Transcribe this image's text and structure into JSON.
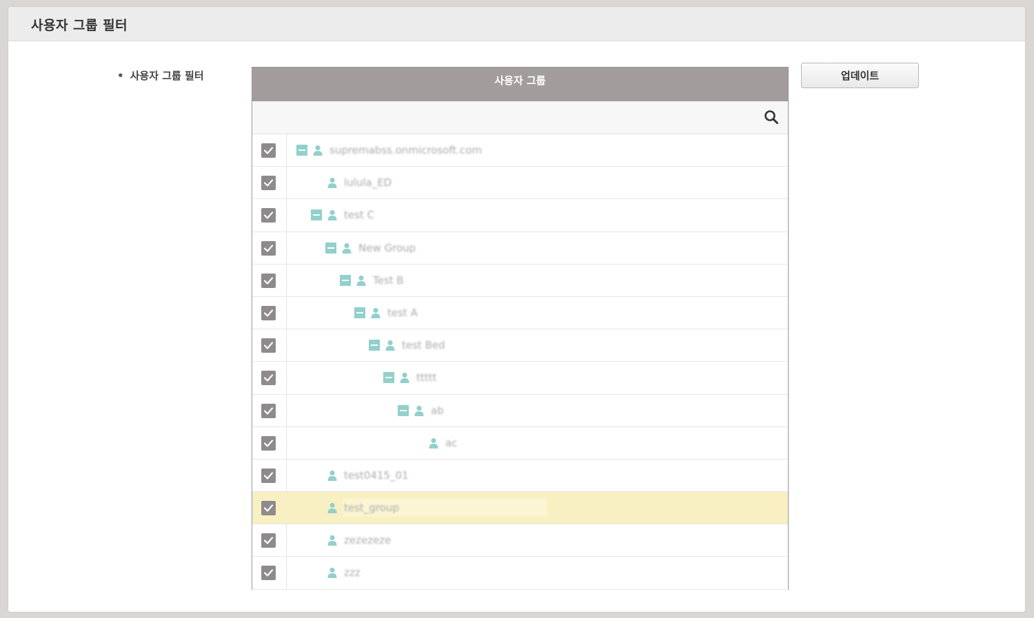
{
  "panel": {
    "title": "사용자 그룹 필터"
  },
  "field": {
    "bullet": "•",
    "label": "사용자 그룹 필터"
  },
  "group_table": {
    "header": "사용자 그룹",
    "rows": [
      {
        "label": "supremabss.onmicrosoft.com",
        "level": 0,
        "expandable": true,
        "checked": true
      },
      {
        "label": "lulula_ED",
        "level": 1,
        "expandable": false,
        "checked": true
      },
      {
        "label": "test C",
        "level": 1,
        "expandable": true,
        "checked": true
      },
      {
        "label": "New Group",
        "level": 2,
        "expandable": true,
        "checked": true
      },
      {
        "label": "Test B",
        "level": 3,
        "expandable": true,
        "checked": true
      },
      {
        "label": "test A",
        "level": 4,
        "expandable": true,
        "checked": true
      },
      {
        "label": "test Bed",
        "level": 5,
        "expandable": true,
        "checked": true
      },
      {
        "label": "ttttt",
        "level": 6,
        "expandable": true,
        "checked": true
      },
      {
        "label": "ab",
        "level": 7,
        "expandable": true,
        "checked": true
      },
      {
        "label": "ac",
        "level": 8,
        "expandable": false,
        "checked": true
      },
      {
        "label": "test0415_01",
        "level": 1,
        "expandable": false,
        "checked": true
      },
      {
        "label": "test_group",
        "level": 1,
        "expandable": false,
        "checked": true,
        "highlighted": true
      },
      {
        "label": "zezezeze",
        "level": 1,
        "expandable": false,
        "checked": true
      },
      {
        "label": "zzz",
        "level": 1,
        "expandable": false,
        "checked": true
      }
    ]
  },
  "actions": {
    "update_label": "업데이트"
  },
  "colors": {
    "header_bg": "#a39c9d",
    "checkbox": "#8f8a8b",
    "accent_teal": "#92d0cb",
    "highlight_row": "#f8f0c2"
  },
  "icons": {
    "search": "search-icon",
    "checkbox": "checkbox-checked-icon",
    "expander": "collapse-minus-icon",
    "group": "person-icon"
  }
}
